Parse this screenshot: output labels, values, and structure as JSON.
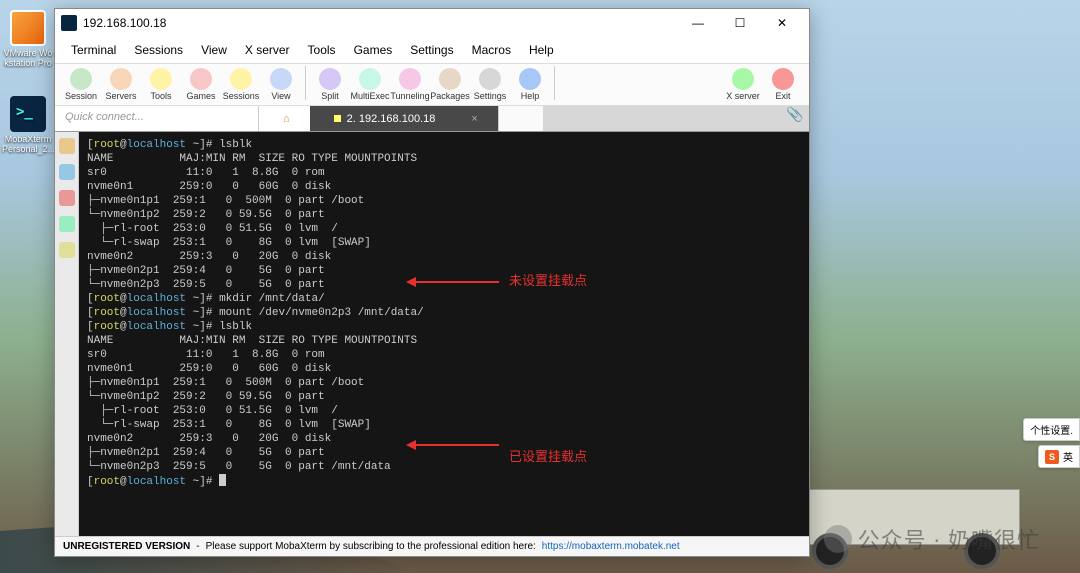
{
  "desktop": {
    "vmware_label": "VMware Wo\nkstation Pro",
    "mobax_label": "MobaXterm\nPersonal_2..."
  },
  "window": {
    "title": "192.168.100.18",
    "minimize": "—",
    "maximize": "☐",
    "close": "✕"
  },
  "menu": [
    "Terminal",
    "Sessions",
    "View",
    "X server",
    "Tools",
    "Games",
    "Settings",
    "Macros",
    "Help"
  ],
  "toolbar": {
    "left": [
      {
        "label": "Session",
        "color": "#c7e7c7"
      },
      {
        "label": "Servers",
        "color": "#f7d7b7"
      },
      {
        "label": "Tools",
        "color": "#fff3a7"
      },
      {
        "label": "Games",
        "color": "#f7c7c7"
      },
      {
        "label": "Sessions",
        "color": "#fff3a7"
      },
      {
        "label": "View",
        "color": "#c7d7f7"
      },
      {
        "label": "Split",
        "color": "#d7c7f7"
      },
      {
        "label": "MultiExec",
        "color": "#c7f7e7"
      },
      {
        "label": "Tunneling",
        "color": "#f7c7e7"
      },
      {
        "label": "Packages",
        "color": "#e7d7c7"
      },
      {
        "label": "Settings",
        "color": "#d7d7d7"
      },
      {
        "label": "Help",
        "color": "#a7c7f7"
      }
    ],
    "right": [
      {
        "label": "X server",
        "color": "#a7f7a7"
      },
      {
        "label": "Exit",
        "color": "#f79797"
      }
    ]
  },
  "tabs": {
    "quick_connect": "Quick connect...",
    "home_icon": "⌂",
    "session_label": "2. 192.168.100.18",
    "session_close": "×",
    "attach": "📎"
  },
  "terminal_columns": "NAME          MAJ:MIN RM  SIZE RO TYPE MOUNTPOINTS",
  "terminal_lines": [
    {
      "t": "prompt",
      "user": "root",
      "host": "localhost",
      "dir": "~",
      "cmd": "lsblk"
    },
    {
      "t": "header"
    },
    {
      "t": "row",
      "c": [
        "sr0          ",
        "11:0",
        "   1",
        "  8.8G",
        "  0",
        " rom",
        ""
      ]
    },
    {
      "t": "row",
      "c": [
        "nvme0n1      ",
        "259:0",
        "   0",
        "   60G",
        "  0",
        " disk",
        ""
      ]
    },
    {
      "t": "row",
      "c": [
        "├─nvme0n1p1 ",
        "259:1",
        "   0",
        "  500M",
        "  0",
        " part",
        " /boot"
      ]
    },
    {
      "t": "row",
      "c": [
        "└─nvme0n1p2 ",
        "259:2",
        "   0",
        " 59.5G",
        "  0",
        " part",
        ""
      ]
    },
    {
      "t": "row",
      "c": [
        "  ├─rl-root ",
        "253:0",
        "   0",
        " 51.5G",
        "  0",
        " lvm",
        "  /"
      ]
    },
    {
      "t": "row",
      "c": [
        "  └─rl-swap ",
        "253:1",
        "   0",
        "    8G",
        "  0",
        " lvm",
        "  [SWAP]"
      ]
    },
    {
      "t": "row",
      "c": [
        "nvme0n2      ",
        "259:3",
        "   0",
        "   20G",
        "  0",
        " disk",
        ""
      ]
    },
    {
      "t": "row",
      "c": [
        "├─nvme0n2p1 ",
        "259:4",
        "   0",
        "    5G",
        "  0",
        " part",
        ""
      ]
    },
    {
      "t": "row",
      "c": [
        "└─nvme0n2p3 ",
        "259:5",
        "   0",
        "    5G",
        "  0",
        " part",
        ""
      ]
    },
    {
      "t": "prompt",
      "user": "root",
      "host": "localhost",
      "dir": "~",
      "cmd": "mkdir /mnt/data/"
    },
    {
      "t": "prompt",
      "user": "root",
      "host": "localhost",
      "dir": "~",
      "cmd": "mount /dev/nvme0n2p3 /mnt/data/"
    },
    {
      "t": "prompt",
      "user": "root",
      "host": "localhost",
      "dir": "~",
      "cmd": "lsblk"
    },
    {
      "t": "header"
    },
    {
      "t": "row",
      "c": [
        "sr0          ",
        "11:0",
        "   1",
        "  8.8G",
        "  0",
        " rom",
        ""
      ]
    },
    {
      "t": "row",
      "c": [
        "nvme0n1      ",
        "259:0",
        "   0",
        "   60G",
        "  0",
        " disk",
        ""
      ]
    },
    {
      "t": "row",
      "c": [
        "├─nvme0n1p1 ",
        "259:1",
        "   0",
        "  500M",
        "  0",
        " part",
        " /boot"
      ]
    },
    {
      "t": "row",
      "c": [
        "└─nvme0n1p2 ",
        "259:2",
        "   0",
        " 59.5G",
        "  0",
        " part",
        ""
      ]
    },
    {
      "t": "row",
      "c": [
        "  ├─rl-root ",
        "253:0",
        "   0",
        " 51.5G",
        "  0",
        " lvm",
        "  /"
      ]
    },
    {
      "t": "row",
      "c": [
        "  └─rl-swap ",
        "253:1",
        "   0",
        "    8G",
        "  0",
        " lvm",
        "  [SWAP]"
      ]
    },
    {
      "t": "row",
      "c": [
        "nvme0n2      ",
        "259:3",
        "   0",
        "   20G",
        "  0",
        " disk",
        ""
      ]
    },
    {
      "t": "row",
      "c": [
        "├─nvme0n2p1 ",
        "259:4",
        "   0",
        "    5G",
        "  0",
        " part",
        ""
      ]
    },
    {
      "t": "row",
      "c": [
        "└─nvme0n2p3 ",
        "259:5",
        "   0",
        "    5G",
        "  0",
        " part",
        " /mnt/data"
      ]
    },
    {
      "t": "prompt",
      "user": "root",
      "host": "localhost",
      "dir": "~",
      "cmd": ""
    }
  ],
  "annotations": {
    "unset": "未设置挂载点",
    "set": "已设置挂载点"
  },
  "footer": {
    "unreg": "UNREGISTERED VERSION",
    "dash": "-",
    "msg": "Please support MobaXterm by subscribing to the professional edition here:",
    "url": "https://mobaxterm.mobatek.net"
  },
  "right_panel": {
    "personalize": "个性设置.",
    "ime": "英"
  },
  "watermark": "公众号 · 奶嘴很忙"
}
